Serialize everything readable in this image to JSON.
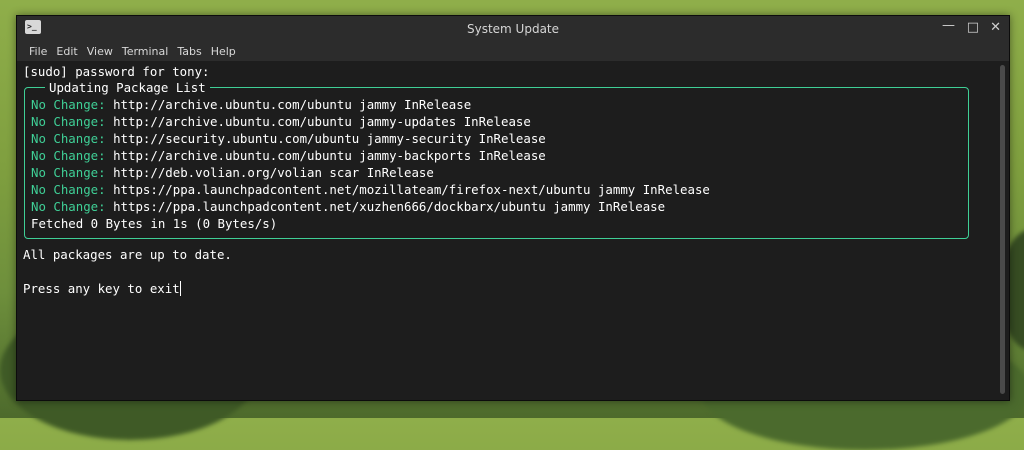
{
  "window": {
    "title": "System Update",
    "icon_label": ">_"
  },
  "controls": {
    "minimize": "—",
    "maximize": "□",
    "close": "✕"
  },
  "menu": [
    "File",
    "Edit",
    "View",
    "Terminal",
    "Tabs",
    "Help"
  ],
  "terminal": {
    "prompt_line": "[sudo] password for tony:",
    "box_title": "Updating Package List",
    "status_prefix": "No Change:",
    "entries": [
      "http://archive.ubuntu.com/ubuntu jammy InRelease",
      "http://archive.ubuntu.com/ubuntu jammy-updates InRelease",
      "http://security.ubuntu.com/ubuntu jammy-security InRelease",
      "http://archive.ubuntu.com/ubuntu jammy-backports InRelease",
      "http://deb.volian.org/volian scar InRelease",
      "https://ppa.launchpadcontent.net/mozillateam/firefox-next/ubuntu jammy InRelease",
      "https://ppa.launchpadcontent.net/xuzhen666/dockbarx/ubuntu jammy InRelease"
    ],
    "fetched_line": "Fetched 0 Bytes in 1s (0 Bytes/s)",
    "result_line": "All packages are up to date.",
    "exit_line": "Press any key to exit"
  },
  "colors": {
    "accent_green": "#3fcf96",
    "terminal_bg": "#1d1d1d",
    "chrome_bg": "#2c2c2c"
  }
}
